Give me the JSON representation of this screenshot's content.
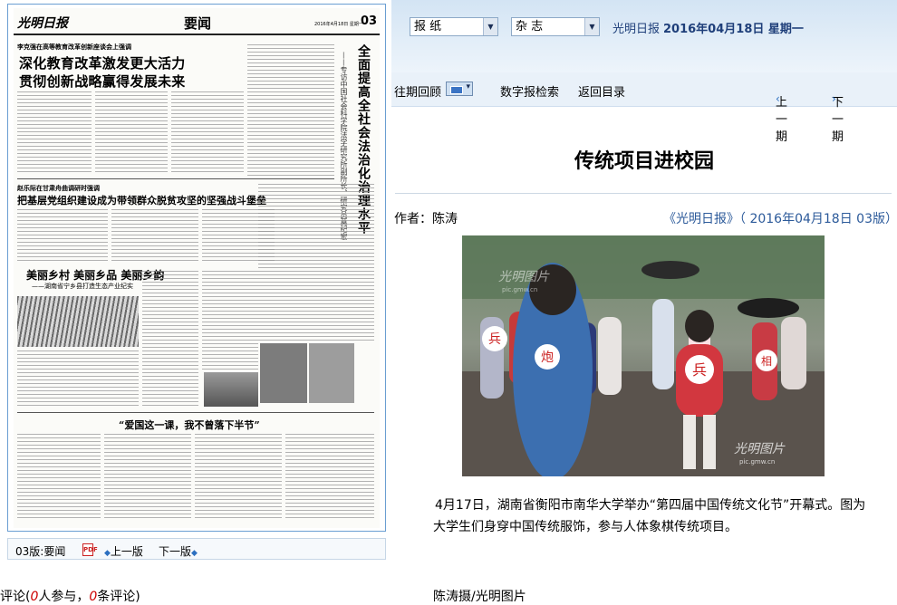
{
  "newspaper": {
    "masthead": "光明日报",
    "section": "要闻",
    "date_line": "2016年4月18日 星期一",
    "page_number": "03",
    "kicker1": "李克强在高等教育改革创新座谈会上强调",
    "headline1_line1": "深化教育改革激发更大活力",
    "headline1_line2": "贯彻创新战略赢得发展未来",
    "kicker2": "赵乐际在甘肃舟曲调研时强调",
    "headline2": "把基层党组织建设成为带领群众脱贫攻坚的坚强战斗堡垒",
    "vertical_headline": "全面提高全社会法治化治理水平",
    "vertical_subtitle": "——专访中国社会科学院法学研究所副所长、研究员莫纪宏",
    "headline3": "美丽乡村  美丽乡品  美丽乡韵",
    "subhead3": "——湖南省宁乡县打造生态产业纪实",
    "headline4": "“爱国这一课，我不曾落下半节”"
  },
  "page_nav": {
    "current": "03版:要闻",
    "pdf_icon": "pdf-icon",
    "prev": "上一版",
    "next": "下一版"
  },
  "comments": {
    "label": "评论(",
    "participants": "0",
    "participants_label": "人参与，",
    "count": "0",
    "count_label": "条评论)"
  },
  "top_bar": {
    "select_paper": "报 纸",
    "select_magazine": "杂 志",
    "paper_name": "光明日报",
    "paper_date": "2016年04月18日 星期一"
  },
  "toolbar": {
    "past_review": "往期回顾",
    "digital_search": "数字报检索",
    "back_to_index": "返回目录",
    "prev_issue": "上一期",
    "next_issue": "下一期"
  },
  "article": {
    "title": "传统项目进校园",
    "author": "作者：陈涛",
    "source": "《光明日报》（ 2016年04月18日 03版）",
    "caption": "4月17日，湖南省衡阳市南华大学举办“第四届中国传统文化节”开幕式。图为大学生们身穿中国传统服饰，参与人体象棋传统项目。",
    "photo_credit": "陈涛摄/光明图片",
    "photo_watermark": "光明图片",
    "photo_watermark_url": "pic.gmw.cn",
    "chess_piece_1": "兵",
    "chess_piece_2": "炮",
    "chess_piece_3": "兵",
    "chess_piece_4": "相"
  },
  "colors": {
    "accent_blue": "#2c6fc0",
    "comment_red": "#cc0000",
    "panel_border": "#6a9ed2"
  }
}
